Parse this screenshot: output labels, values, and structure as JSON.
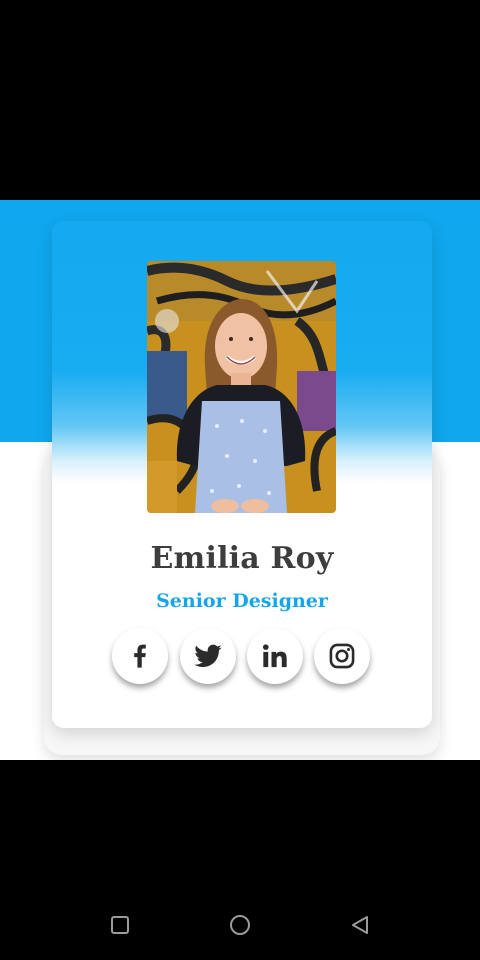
{
  "profile": {
    "name": "Emilia Roy",
    "role": "Senior Designer",
    "photo_icon": "profile-photo"
  },
  "social_links": [
    {
      "icon": "facebook-icon"
    },
    {
      "icon": "twitter-icon"
    },
    {
      "icon": "linkedin-icon"
    },
    {
      "icon": "instagram-icon"
    }
  ],
  "colors": {
    "accent": "#10a7ee",
    "name_text": "#3d3d3d",
    "role_text": "#15a6e9",
    "icon": "#2b2b2b"
  },
  "system_nav": {
    "recents_icon": "square-icon",
    "home_icon": "circle-icon",
    "back_icon": "triangle-back-icon"
  }
}
